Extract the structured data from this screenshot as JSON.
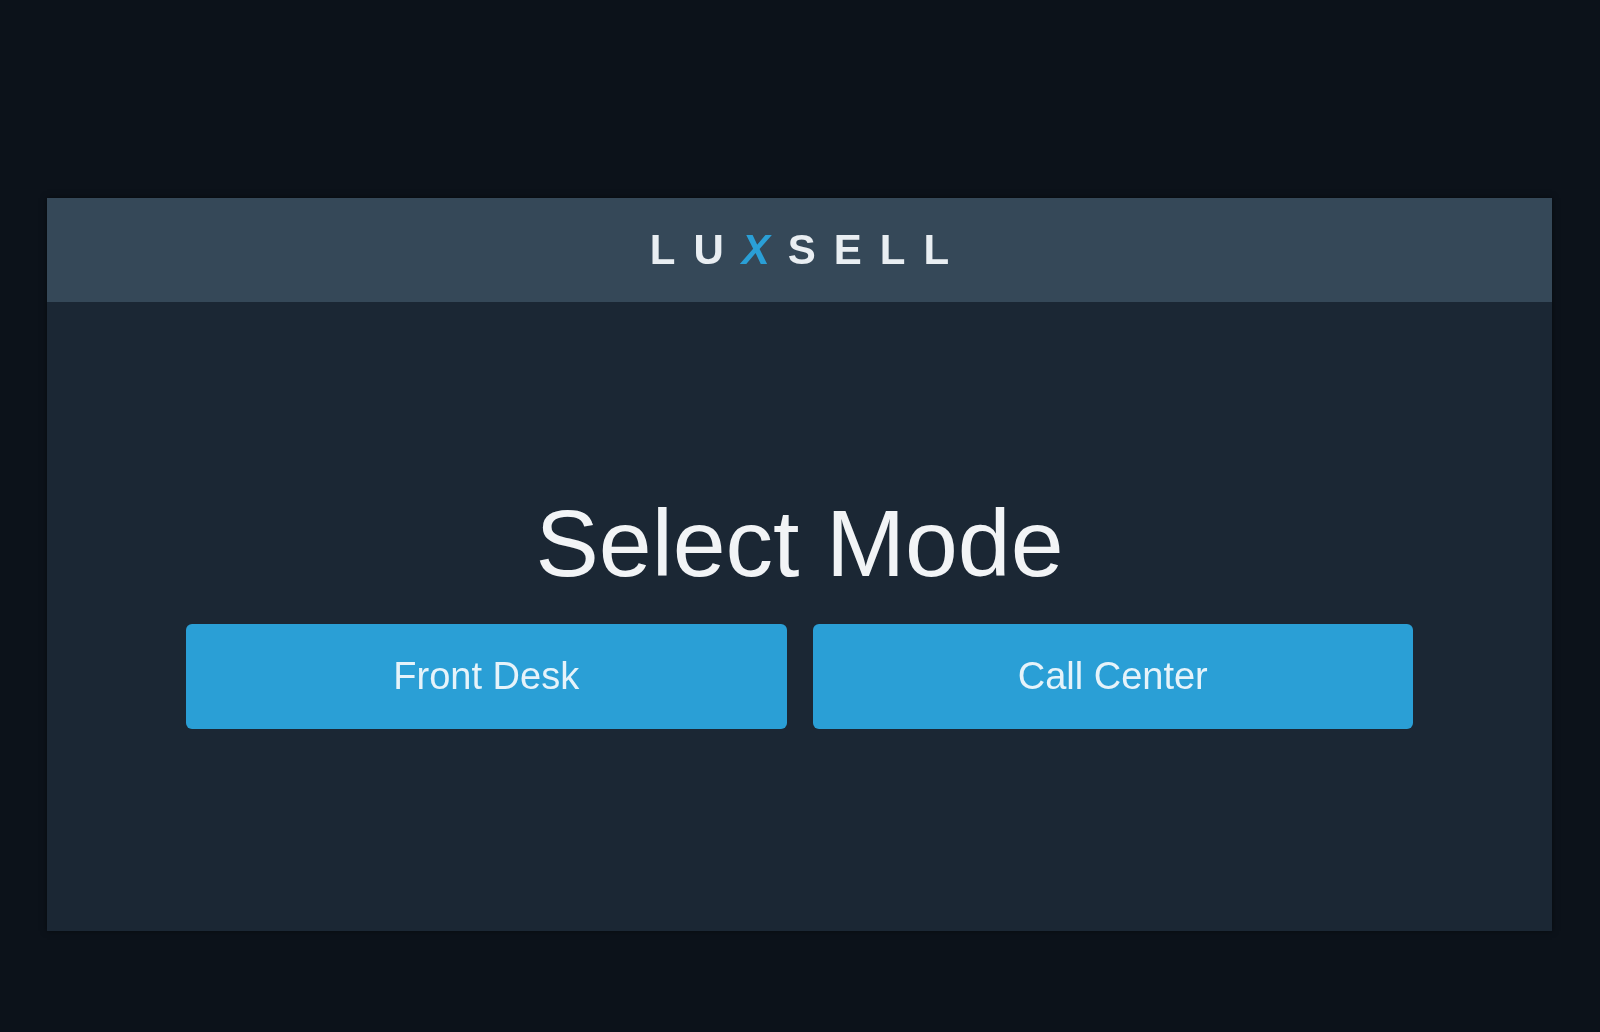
{
  "header": {
    "logo": [
      {
        "text": "LU",
        "accent": false
      },
      {
        "text": "X",
        "accent": true
      },
      {
        "text": "SELL",
        "accent": false
      }
    ]
  },
  "title": "Select Mode",
  "mode_buttons": [
    {
      "label": "Front Desk"
    },
    {
      "label": "Call Center"
    }
  ]
}
